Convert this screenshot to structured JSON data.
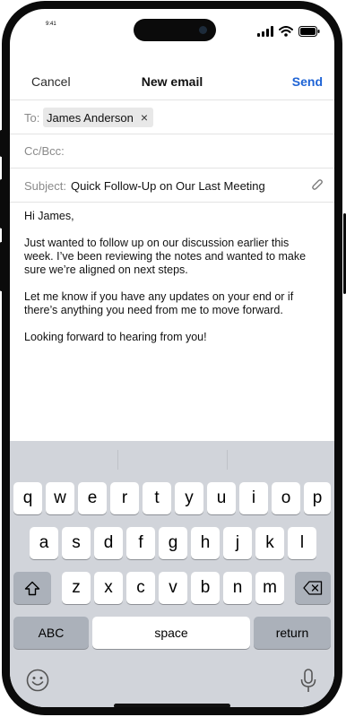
{
  "status": {
    "time": "9:41"
  },
  "header": {
    "cancel_label": "Cancel",
    "title": "New email",
    "send_label": "Send"
  },
  "to": {
    "label": "To:",
    "recipient": "James Anderson",
    "remove_glyph": "×"
  },
  "cc": {
    "label": "Cc/Bcc:"
  },
  "subject": {
    "label": "Subject:",
    "value": "Quick Follow-Up on Our Last Meeting"
  },
  "body": {
    "paragraphs": [
      "Hi James,",
      "Just wanted to follow up on our discussion earlier this week. I’ve been reviewing the notes and wanted to make sure we’re aligned on next steps.",
      "Let me know if you have any updates on your end or if there’s anything you need from me to move forward.",
      "Looking forward to hearing from you!"
    ]
  },
  "keyboard": {
    "row1": [
      "q",
      "w",
      "e",
      "r",
      "t",
      "y",
      "u",
      "i",
      "o",
      "p"
    ],
    "row2": [
      "a",
      "s",
      "d",
      "f",
      "g",
      "h",
      "j",
      "k",
      "l"
    ],
    "row3": [
      "z",
      "x",
      "c",
      "v",
      "b",
      "n",
      "m"
    ],
    "abc_label": "ABC",
    "space_label": "space",
    "return_label": "return"
  },
  "colors": {
    "accent": "#1e63d5",
    "keyboard_bg": "#d1d4da",
    "func_key": "#abb1ba"
  },
  "icons": [
    "signal-icon",
    "wifi-icon",
    "battery-icon",
    "paperclip-icon",
    "shift-icon",
    "backspace-icon",
    "emoji-icon",
    "microphone-icon"
  ]
}
